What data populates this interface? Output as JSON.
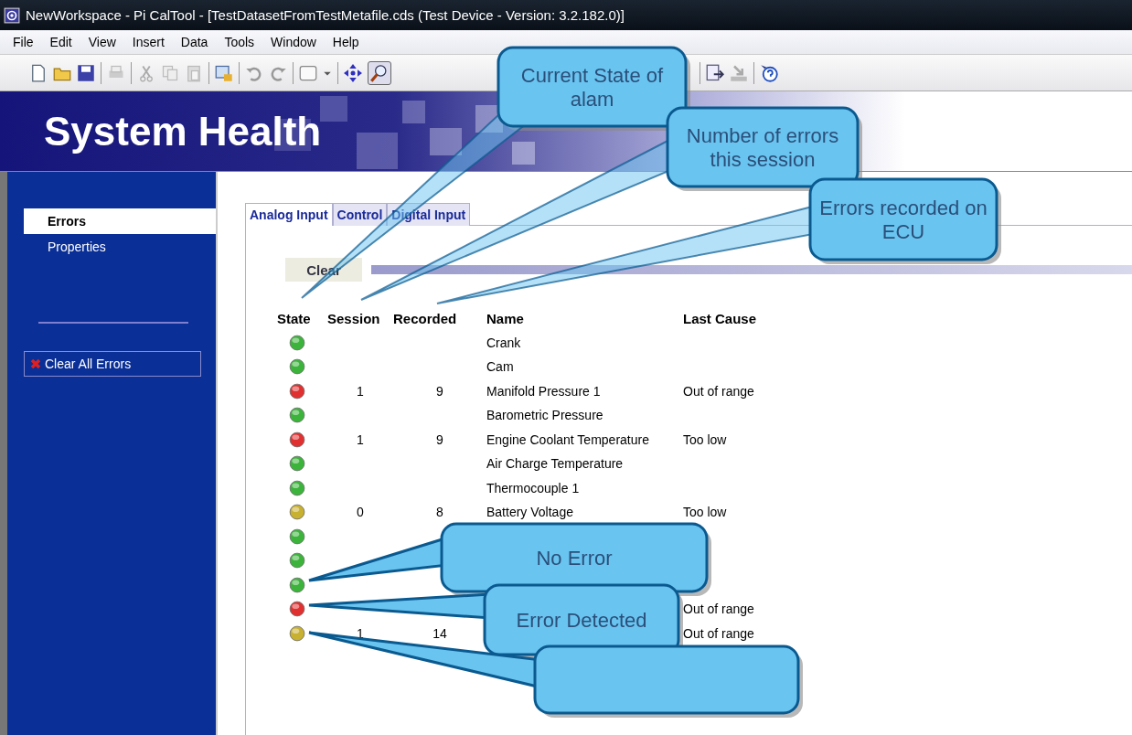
{
  "window": {
    "title": "NewWorkspace - Pi CalTool - [TestDatasetFromTestMetafile.cds (Test Device - Version: 3.2.182.0)]"
  },
  "menu": [
    "File",
    "Edit",
    "View",
    "Insert",
    "Data",
    "Tools",
    "Window",
    "Help"
  ],
  "banner": {
    "title": "System Health"
  },
  "sidebar": {
    "items": [
      {
        "label": "Errors",
        "selected": true
      },
      {
        "label": "Properties",
        "selected": false
      }
    ],
    "clear_all_button": "Clear All Errors"
  },
  "tabs": [
    {
      "label": "Analog Input",
      "selected": true
    },
    {
      "label": "Control",
      "selected": false
    },
    {
      "label": "Digital Input",
      "selected": false
    }
  ],
  "clear_button": "Clear",
  "table": {
    "columns": [
      "State",
      "Session",
      "Recorded",
      "Name",
      "Last Cause"
    ],
    "rows": [
      {
        "color": "#3cb43c",
        "name": "Crank"
      },
      {
        "color": "#3cb43c",
        "name": "Cam"
      },
      {
        "color": "#e03030",
        "session": "1",
        "recorded": "9",
        "name": "Manifold Pressure 1",
        "last_cause": "Out of range"
      },
      {
        "color": "#3cb43c",
        "name": "Barometric Pressure"
      },
      {
        "color": "#e03030",
        "session": "1",
        "recorded": "9",
        "name": "Engine Coolant Temperature",
        "last_cause": "Too low"
      },
      {
        "color": "#3cb43c",
        "name": "Air Charge Temperature"
      },
      {
        "color": "#3cb43c",
        "name": "Thermocouple 1"
      },
      {
        "color": "#c8b030",
        "session": "0",
        "recorded": "8",
        "name": "Battery Voltage",
        "last_cause": "Too low"
      },
      {
        "color": "#3cb43c"
      },
      {
        "color": "#3cb43c"
      },
      {
        "color": "#3cb43c"
      },
      {
        "color": "#e03030",
        "last_cause": "Out of range"
      },
      {
        "color": "#c8b030",
        "session": "1",
        "recorded": "14",
        "last_cause": "Out of range"
      }
    ]
  },
  "callouts": [
    {
      "kind": "labeled",
      "text": "Current State of alam"
    },
    {
      "kind": "labeled",
      "text": "Number of errors this session"
    },
    {
      "kind": "labeled",
      "text": "Errors recorded on ECU"
    },
    {
      "kind": "labeled",
      "text": "No Error"
    },
    {
      "kind": "labeled",
      "text": "Error Detected"
    },
    {
      "kind": "empty"
    }
  ]
}
